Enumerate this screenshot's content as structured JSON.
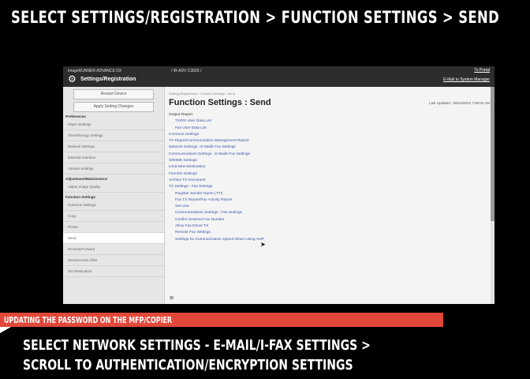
{
  "headline": "SELECT SETTINGS/REGISTRATION > FUNCTION SETTINGS > SEND",
  "screen": {
    "product": "imageRUNNER ADVANCE DX",
    "model": "/ iR-ADV C3826 /",
    "to_portal": "To Portal",
    "sysmgr": "E-Mail to System Manager",
    "app_title": "Settings/Registration",
    "gear_icon": "gear-icon",
    "restart": "Restart Device",
    "apply": "Apply Setting Changes",
    "sections": {
      "preferences": "Preferences",
      "adjustment": "Adjustment/Maintenance",
      "function": "Function Settings"
    },
    "pref_items": [
      "Paper Settings",
      "Timer/Energy Settings",
      "Network Settings",
      "External Interface",
      "Volume Settings"
    ],
    "adj_items": [
      "Adjust Image Quality"
    ],
    "func_items": [
      "Common Settings",
      "Copy",
      "Printer",
      "Send",
      "Receive/Forward",
      "Store/Access Files",
      "Set Destination"
    ],
    "breadcrumb": "Settings/Registration : Function Settings : Send",
    "page_title": "Function Settings : Send",
    "last_updated": "Last Updated : 08/13/2024 7:58:04 AM",
    "links": [
      {
        "text": "Output Report",
        "kind": "plain"
      },
      {
        "text": "TX/RX User Data List",
        "kind": "sub"
      },
      {
        "text": "Fax User Data List",
        "kind": "sub"
      },
      {
        "text": "Common Settings",
        "kind": "link"
      },
      {
        "text": "TX Report/Communication Management Report",
        "kind": "link"
      },
      {
        "text": "Network Settings : E-Mail/I-Fax Settings",
        "kind": "link"
      },
      {
        "text": "Communications Settings : E-Mail/I-Fax Settings",
        "kind": "link"
      },
      {
        "text": "S/MIME Settings",
        "kind": "link"
      },
      {
        "text": "Limit New Destination",
        "kind": "link"
      },
      {
        "text": "Favorite Settings",
        "kind": "link"
      },
      {
        "text": "Archive TX Document",
        "kind": "link"
      },
      {
        "text": "TX Settings : Fax Settings",
        "kind": "link"
      },
      {
        "text": "Register Sender Name (TTI)",
        "kind": "sub"
      },
      {
        "text": "Fax TX Report/Fax Activity Report",
        "kind": "sub"
      },
      {
        "text": "Set Line",
        "kind": "sub"
      },
      {
        "text": "Communications Settings : Fax Settings",
        "kind": "sub"
      },
      {
        "text": "Confirm Entered Fax Number",
        "kind": "sub"
      },
      {
        "text": "Allow Fax Driver TX",
        "kind": "sub"
      },
      {
        "text": "Remote Fax Settings",
        "kind": "sub"
      },
      {
        "text": "Settings for Communication Speed When Using VoIP",
        "kind": "sub"
      }
    ],
    "bottom_icon": "⊠"
  },
  "red_banner": "UPDATING THE PASSWORD ON THE MFP/COPIER",
  "instruction_line1": "SELECT NETWORK SETTINGS - E-MAIL/I-FAX SETTINGS >",
  "instruction_line2": "SCROLL TO AUTHENTICATION/ENCRYPTION SETTINGS"
}
